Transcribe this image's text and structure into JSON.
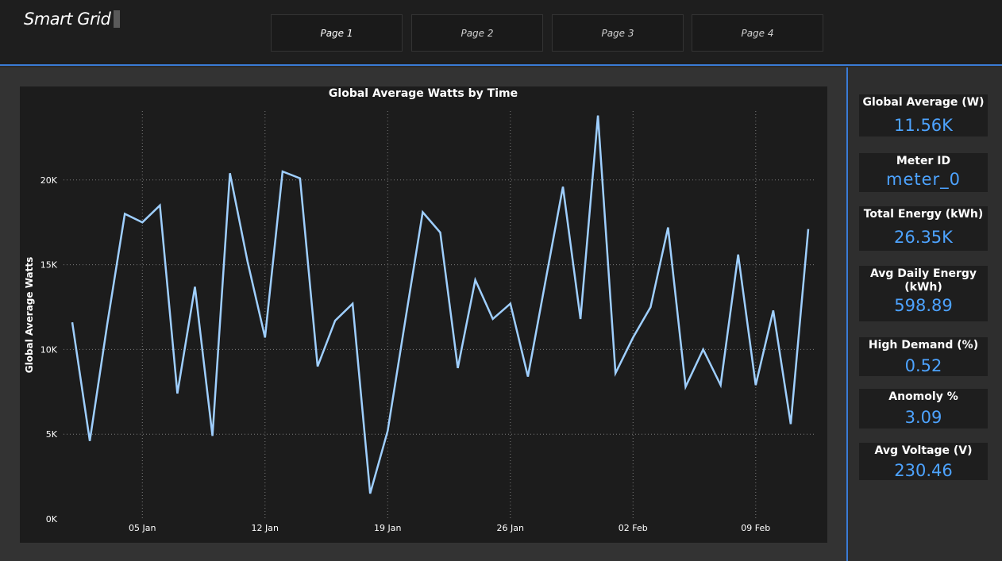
{
  "app": {
    "title": "Smart Grid"
  },
  "tabs": [
    {
      "label": "Page 1",
      "active": true
    },
    {
      "label": "Page 2",
      "active": false
    },
    {
      "label": "Page 3",
      "active": false
    },
    {
      "label": "Page 4",
      "active": false
    }
  ],
  "colors": {
    "accent": "#3a7bd5",
    "line": "#9fcfff",
    "kpi_value": "#4da3ff"
  },
  "chart_data": {
    "type": "line",
    "title": "Global Average Watts by Time",
    "xlabel": "",
    "ylabel": "Global Average Watts",
    "ylim": [
      0,
      25000
    ],
    "y_ticks": [
      0,
      5000,
      10000,
      15000,
      20000
    ],
    "y_tick_labels": [
      "0K",
      "5K",
      "10K",
      "15K",
      "20K"
    ],
    "x_tick_labels": [
      "05 Jan",
      "12 Jan",
      "19 Jan",
      "26 Jan",
      "02 Feb",
      "09 Feb"
    ],
    "grid": true,
    "series": [
      {
        "values": [
          11600,
          4600,
          11500,
          18000,
          17500,
          18500,
          7400,
          13700,
          4900,
          20400,
          15200,
          10700,
          20500,
          20100,
          9000,
          11700,
          12700,
          1500,
          5200,
          11700,
          18100,
          16900,
          8900,
          14100,
          11800,
          12700,
          8400,
          14000,
          19600,
          11800,
          23800,
          8600,
          10700,
          12500,
          17200,
          7800,
          10000,
          7900,
          15600,
          7900,
          12300,
          5600,
          17100
        ]
      }
    ]
  },
  "kpis": [
    {
      "label": "Global Average (W)",
      "value": "11.56K"
    },
    {
      "label": "Meter ID",
      "value": "meter_0"
    },
    {
      "label": "Total Energy (kWh)",
      "value": "26.35K"
    },
    {
      "label": "Avg Daily Energy (kWh)",
      "value": "598.89"
    },
    {
      "label": "High Demand (%)",
      "value": "0.52"
    },
    {
      "label": "Anomoly %",
      "value": "3.09"
    },
    {
      "label": "Avg Voltage (V)",
      "value": "230.46"
    }
  ]
}
